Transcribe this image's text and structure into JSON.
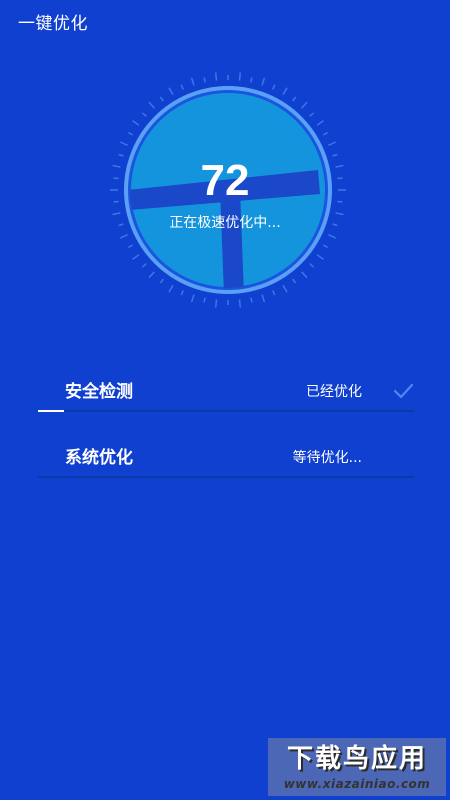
{
  "header": {
    "title": "一键优化"
  },
  "gauge": {
    "score": "72",
    "status": "正在极速优化中..."
  },
  "tasks": [
    {
      "label": "安全检测",
      "status": "已经优化",
      "done": true,
      "progress": 0.07
    },
    {
      "label": "系统优化",
      "status": "等待优化...",
      "done": false,
      "progress": 0
    }
  ],
  "watermark": {
    "title": "下载鸟应用",
    "url": "www.xiazainiao.com"
  },
  "colors": {
    "background": "#1040cf",
    "ring": "#5aa0f5",
    "dial": "#1494dc",
    "check": "#4a8af0"
  }
}
